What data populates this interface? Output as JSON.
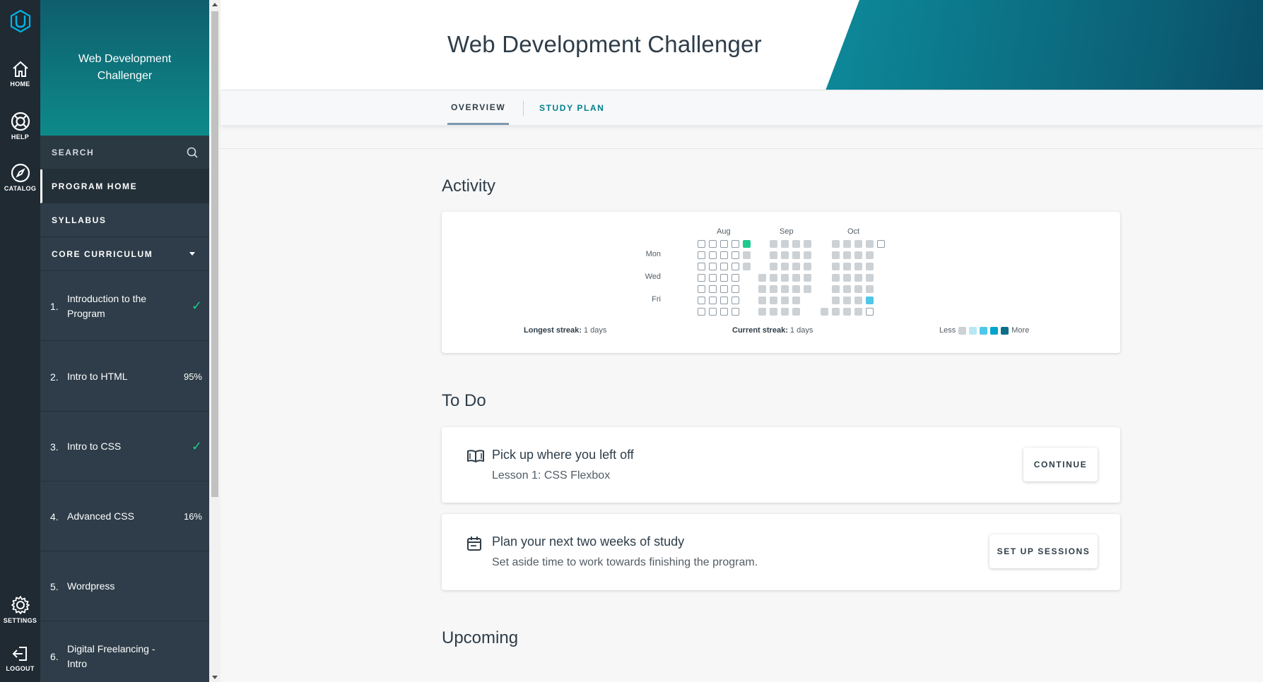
{
  "rail": {
    "items": [
      {
        "label": "HOME",
        "icon": "home-icon"
      },
      {
        "label": "HELP",
        "icon": "lifebuoy-icon"
      },
      {
        "label": "CATALOG",
        "icon": "compass-icon"
      },
      {
        "label": "SETTINGS",
        "icon": "gear-icon"
      },
      {
        "label": "LOGOUT",
        "icon": "logout-icon"
      }
    ]
  },
  "sidebar": {
    "program_title": "Web Development Challenger",
    "search_label": "SEARCH",
    "program_home": "PROGRAM HOME",
    "syllabus": "SYLLABUS",
    "core_curriculum": "CORE CURRICULUM",
    "lessons": [
      {
        "num": "1.",
        "name": "Introduction to the Program",
        "status": "✓"
      },
      {
        "num": "2.",
        "name": "Intro to HTML",
        "status": "95%"
      },
      {
        "num": "3.",
        "name": "Intro to CSS",
        "status": "✓"
      },
      {
        "num": "4.",
        "name": "Advanced CSS",
        "status": "16%"
      },
      {
        "num": "5.",
        "name": "Wordpress",
        "status": ""
      },
      {
        "num": "6.",
        "name": "Digital Freelancing - Intro",
        "status": ""
      }
    ]
  },
  "header": {
    "title": "Web Development Challenger",
    "tabs": [
      {
        "label": "OVERVIEW"
      },
      {
        "label": "STUDY PLAN"
      }
    ]
  },
  "activity": {
    "section_title": "Activity",
    "months": [
      "Aug",
      "Sep",
      "Oct"
    ],
    "days": [
      "Mon",
      "Wed",
      "Fri"
    ],
    "longest_streak_label": "Longest streak:",
    "longest_streak_value": "1 days",
    "current_streak_label": "Current streak:",
    "current_streak_value": "1 days",
    "legend_less": "Less",
    "legend_more": "More",
    "legend_colors": [
      "#ccd1d5",
      "#b9e8f5",
      "#4fc7e8",
      "#02a3cf",
      "#0b6f8a"
    ]
  },
  "todo": {
    "section_title": "To Do",
    "items": [
      {
        "title": "Pick up where you left off",
        "subtitle": "Lesson 1: CSS Flexbox",
        "button": "CONTINUE",
        "icon": "book-icon"
      },
      {
        "title": "Plan your next two weeks of study",
        "subtitle": "Set aside time to work towards finishing the program.",
        "button": "SET UP SESSIONS",
        "icon": "calendar-icon"
      }
    ]
  },
  "upcoming": {
    "section_title": "Upcoming"
  },
  "colors": {
    "rail_bg": "#1f2a33",
    "sidebar_bg": "#2e3d49",
    "accent_teal": "#02808f",
    "check_green": "#1ecb8c"
  }
}
